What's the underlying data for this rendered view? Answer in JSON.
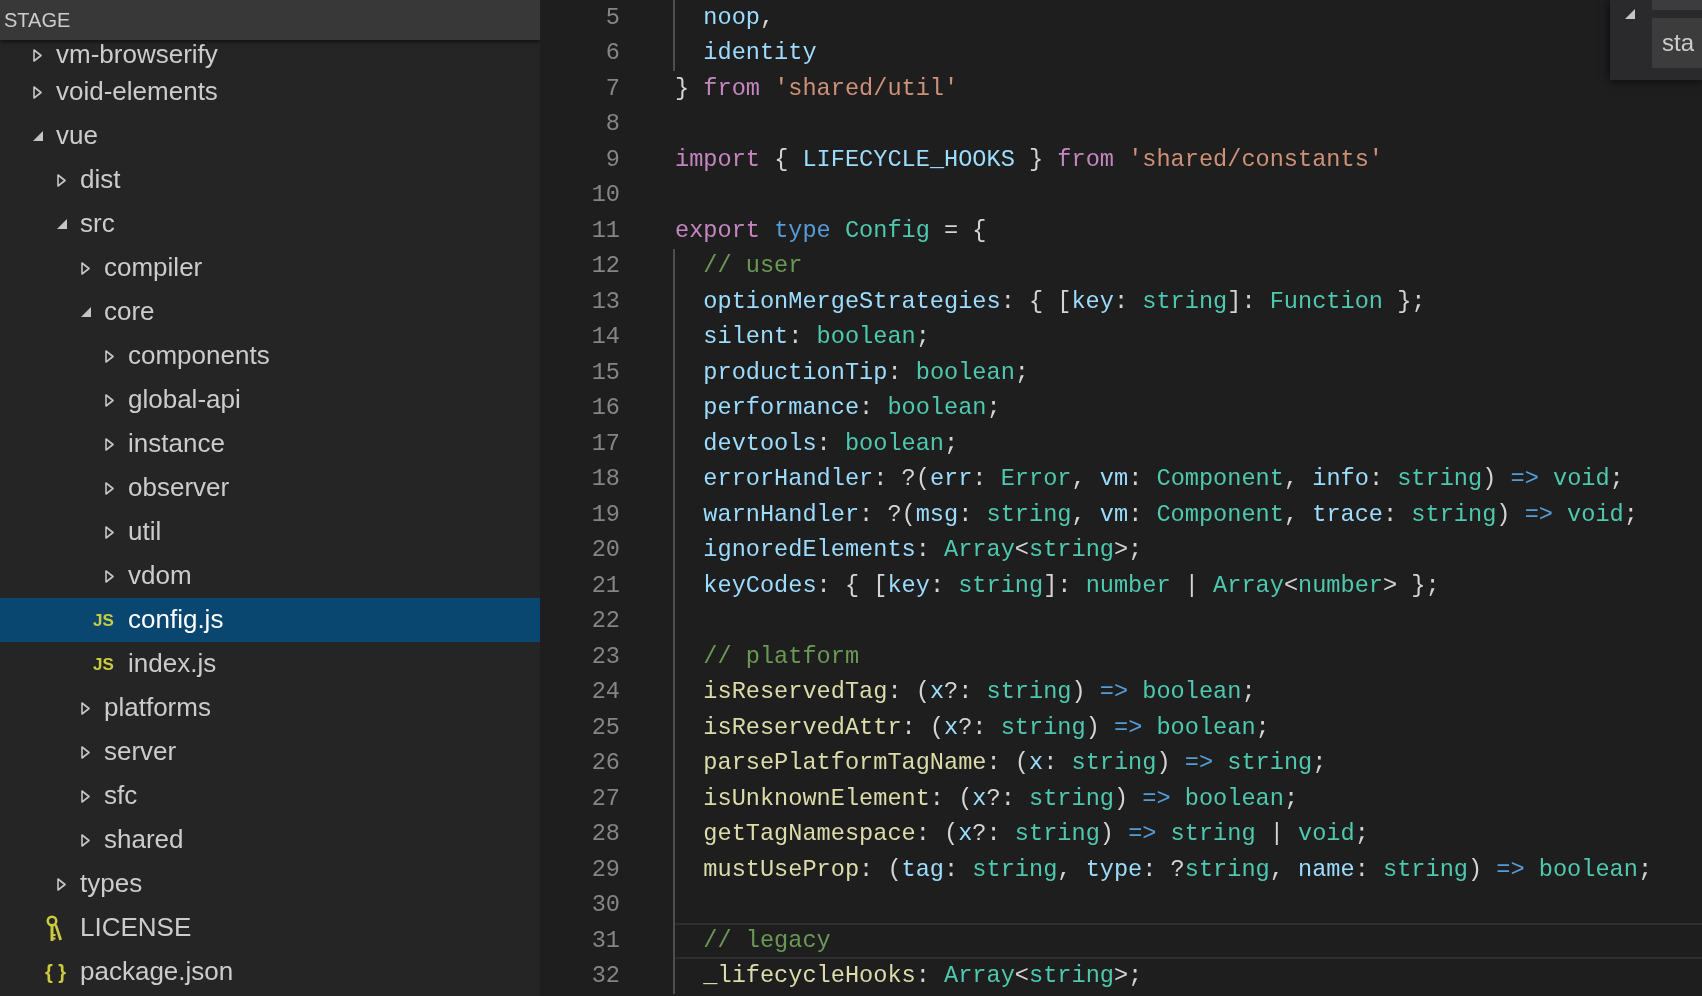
{
  "sidebar": {
    "header": "STAGE",
    "items": [
      {
        "kind": "folder",
        "name": "vm-browserify",
        "expanded": false,
        "selected": false
      },
      {
        "kind": "folder",
        "name": "void-elements",
        "expanded": false,
        "selected": false
      },
      {
        "kind": "folder",
        "name": "vue",
        "expanded": true,
        "selected": false,
        "children": [
          {
            "kind": "folder",
            "name": "dist",
            "expanded": false,
            "selected": false
          },
          {
            "kind": "folder",
            "name": "src",
            "expanded": true,
            "selected": false,
            "children": [
              {
                "kind": "folder",
                "name": "compiler",
                "expanded": false,
                "selected": false
              },
              {
                "kind": "folder",
                "name": "core",
                "expanded": true,
                "selected": false,
                "children": [
                  {
                    "kind": "folder",
                    "name": "components",
                    "expanded": false,
                    "selected": false
                  },
                  {
                    "kind": "folder",
                    "name": "global-api",
                    "expanded": false,
                    "selected": false
                  },
                  {
                    "kind": "folder",
                    "name": "instance",
                    "expanded": false,
                    "selected": false
                  },
                  {
                    "kind": "folder",
                    "name": "observer",
                    "expanded": false,
                    "selected": false
                  },
                  {
                    "kind": "folder",
                    "name": "util",
                    "expanded": false,
                    "selected": false
                  },
                  {
                    "kind": "folder",
                    "name": "vdom",
                    "expanded": false,
                    "selected": false
                  },
                  {
                    "kind": "script",
                    "glyph": "JS",
                    "name": "config.js",
                    "selected": true
                  },
                  {
                    "kind": "script",
                    "glyph": "JS",
                    "name": "index.js",
                    "selected": false
                  }
                ]
              },
              {
                "kind": "folder",
                "name": "platforms",
                "expanded": false,
                "selected": false
              },
              {
                "kind": "folder",
                "name": "server",
                "expanded": false,
                "selected": false
              },
              {
                "kind": "folder",
                "name": "sfc",
                "expanded": false,
                "selected": false
              },
              {
                "kind": "folder",
                "name": "shared",
                "expanded": false,
                "selected": false
              }
            ]
          },
          {
            "kind": "folder",
            "name": "types",
            "expanded": false,
            "selected": false
          },
          {
            "kind": "license",
            "name": "LICENSE",
            "selected": false
          },
          {
            "kind": "json",
            "glyph": "{ }",
            "name": "package.json",
            "selected": false
          }
        ]
      }
    ]
  },
  "editor": {
    "lines": [
      {
        "number": "5",
        "guide": true,
        "current": false,
        "tokens": [
          {
            "kind": "variable",
            "text": "  noop"
          },
          {
            "kind": "punct",
            "text": ","
          }
        ]
      },
      {
        "number": "6",
        "guide": true,
        "current": false,
        "tokens": [
          {
            "kind": "variable",
            "text": "  identity"
          }
        ]
      },
      {
        "number": "7",
        "guide": false,
        "current": false,
        "tokens": [
          {
            "kind": "punct",
            "text": "} "
          },
          {
            "kind": "keyword",
            "text": "from "
          },
          {
            "kind": "string",
            "text": "'shared/util'"
          }
        ]
      },
      {
        "number": "8",
        "guide": false,
        "current": false
      },
      {
        "number": "9",
        "guide": false,
        "current": false,
        "tokens": [
          {
            "kind": "keyword",
            "text": "import "
          },
          {
            "kind": "punct",
            "text": "{ "
          },
          {
            "kind": "variable",
            "text": "LIFECYCLE_HOOKS "
          },
          {
            "kind": "punct",
            "text": "} "
          },
          {
            "kind": "keyword",
            "text": "from "
          },
          {
            "kind": "string",
            "text": "'shared/constants'"
          }
        ]
      },
      {
        "number": "10",
        "guide": false,
        "current": false
      },
      {
        "number": "11",
        "guide": false,
        "current": false,
        "tokens": [
          {
            "kind": "keyword",
            "text": "export "
          },
          {
            "kind": "storage",
            "text": "type "
          },
          {
            "kind": "type",
            "text": "Config "
          },
          {
            "kind": "punct",
            "text": "= {"
          }
        ]
      },
      {
        "number": "12",
        "guide": true,
        "current": false,
        "tokens": [
          {
            "kind": "comment",
            "text": "  // user"
          }
        ]
      },
      {
        "number": "13",
        "guide": true,
        "current": false,
        "tokens": [
          {
            "kind": "variable",
            "text": "  optionMergeStrategies"
          },
          {
            "kind": "punct",
            "text": ": { ["
          },
          {
            "kind": "variable",
            "text": "key"
          },
          {
            "kind": "punct",
            "text": ": "
          },
          {
            "kind": "type",
            "text": "string"
          },
          {
            "kind": "punct",
            "text": "]: "
          },
          {
            "kind": "type",
            "text": "Function"
          },
          {
            "kind": "punct",
            "text": " };"
          }
        ]
      },
      {
        "number": "14",
        "guide": true,
        "current": false,
        "tokens": [
          {
            "kind": "variable",
            "text": "  silent"
          },
          {
            "kind": "punct",
            "text": ": "
          },
          {
            "kind": "type",
            "text": "boolean"
          },
          {
            "kind": "punct",
            "text": ";"
          }
        ]
      },
      {
        "number": "15",
        "guide": true,
        "current": false,
        "tokens": [
          {
            "kind": "variable",
            "text": "  productionTip"
          },
          {
            "kind": "punct",
            "text": ": "
          },
          {
            "kind": "type",
            "text": "boolean"
          },
          {
            "kind": "punct",
            "text": ";"
          }
        ]
      },
      {
        "number": "16",
        "guide": true,
        "current": false,
        "tokens": [
          {
            "kind": "variable",
            "text": "  performance"
          },
          {
            "kind": "punct",
            "text": ": "
          },
          {
            "kind": "type",
            "text": "boolean"
          },
          {
            "kind": "punct",
            "text": ";"
          }
        ]
      },
      {
        "number": "17",
        "guide": true,
        "current": false,
        "tokens": [
          {
            "kind": "variable",
            "text": "  devtools"
          },
          {
            "kind": "punct",
            "text": ": "
          },
          {
            "kind": "type",
            "text": "boolean"
          },
          {
            "kind": "punct",
            "text": ";"
          }
        ]
      },
      {
        "number": "18",
        "guide": true,
        "current": false,
        "tokens": [
          {
            "kind": "variable",
            "text": "  errorHandler"
          },
          {
            "kind": "punct",
            "text": ": ?("
          },
          {
            "kind": "variable",
            "text": "err"
          },
          {
            "kind": "punct",
            "text": ": "
          },
          {
            "kind": "type",
            "text": "Error"
          },
          {
            "kind": "punct",
            "text": ", "
          },
          {
            "kind": "variable",
            "text": "vm"
          },
          {
            "kind": "punct",
            "text": ": "
          },
          {
            "kind": "type",
            "text": "Component"
          },
          {
            "kind": "punct",
            "text": ", "
          },
          {
            "kind": "variable",
            "text": "info"
          },
          {
            "kind": "punct",
            "text": ": "
          },
          {
            "kind": "type",
            "text": "string"
          },
          {
            "kind": "punct",
            "text": ") "
          },
          {
            "kind": "storage",
            "text": "=> "
          },
          {
            "kind": "type",
            "text": "void"
          },
          {
            "kind": "punct",
            "text": ";"
          }
        ]
      },
      {
        "number": "19",
        "guide": true,
        "current": false,
        "tokens": [
          {
            "kind": "variable",
            "text": "  warnHandler"
          },
          {
            "kind": "punct",
            "text": ": ?("
          },
          {
            "kind": "variable",
            "text": "msg"
          },
          {
            "kind": "punct",
            "text": ": "
          },
          {
            "kind": "type",
            "text": "string"
          },
          {
            "kind": "punct",
            "text": ", "
          },
          {
            "kind": "variable",
            "text": "vm"
          },
          {
            "kind": "punct",
            "text": ": "
          },
          {
            "kind": "type",
            "text": "Component"
          },
          {
            "kind": "punct",
            "text": ", "
          },
          {
            "kind": "variable",
            "text": "trace"
          },
          {
            "kind": "punct",
            "text": ": "
          },
          {
            "kind": "type",
            "text": "string"
          },
          {
            "kind": "punct",
            "text": ") "
          },
          {
            "kind": "storage",
            "text": "=> "
          },
          {
            "kind": "type",
            "text": "void"
          },
          {
            "kind": "punct",
            "text": ";"
          }
        ]
      },
      {
        "number": "20",
        "guide": true,
        "current": false,
        "tokens": [
          {
            "kind": "variable",
            "text": "  ignoredElements"
          },
          {
            "kind": "punct",
            "text": ": "
          },
          {
            "kind": "type",
            "text": "Array"
          },
          {
            "kind": "punct",
            "text": "<"
          },
          {
            "kind": "type",
            "text": "string"
          },
          {
            "kind": "punct",
            "text": ">;"
          }
        ]
      },
      {
        "number": "21",
        "guide": true,
        "current": false,
        "tokens": [
          {
            "kind": "variable",
            "text": "  keyCodes"
          },
          {
            "kind": "punct",
            "text": ": { ["
          },
          {
            "kind": "variable",
            "text": "key"
          },
          {
            "kind": "punct",
            "text": ": "
          },
          {
            "kind": "type",
            "text": "string"
          },
          {
            "kind": "punct",
            "text": "]: "
          },
          {
            "kind": "type",
            "text": "number"
          },
          {
            "kind": "punct",
            "text": " | "
          },
          {
            "kind": "type",
            "text": "Array"
          },
          {
            "kind": "punct",
            "text": "<"
          },
          {
            "kind": "type",
            "text": "number"
          },
          {
            "kind": "punct",
            "text": "> };"
          }
        ]
      },
      {
        "number": "22",
        "guide": true,
        "current": false
      },
      {
        "number": "23",
        "guide": true,
        "current": false,
        "tokens": [
          {
            "kind": "comment",
            "text": "  // platform"
          }
        ]
      },
      {
        "number": "24",
        "guide": true,
        "current": false,
        "tokens": [
          {
            "kind": "function",
            "text": "  isReservedTag"
          },
          {
            "kind": "punct",
            "text": ": ("
          },
          {
            "kind": "variable",
            "text": "x"
          },
          {
            "kind": "punct",
            "text": "?: "
          },
          {
            "kind": "type",
            "text": "string"
          },
          {
            "kind": "punct",
            "text": ") "
          },
          {
            "kind": "storage",
            "text": "=> "
          },
          {
            "kind": "type",
            "text": "boolean"
          },
          {
            "kind": "punct",
            "text": ";"
          }
        ]
      },
      {
        "number": "25",
        "guide": true,
        "current": false,
        "tokens": [
          {
            "kind": "function",
            "text": "  isReservedAttr"
          },
          {
            "kind": "punct",
            "text": ": ("
          },
          {
            "kind": "variable",
            "text": "x"
          },
          {
            "kind": "punct",
            "text": "?: "
          },
          {
            "kind": "type",
            "text": "string"
          },
          {
            "kind": "punct",
            "text": ") "
          },
          {
            "kind": "storage",
            "text": "=> "
          },
          {
            "kind": "type",
            "text": "boolean"
          },
          {
            "kind": "punct",
            "text": ";"
          }
        ]
      },
      {
        "number": "26",
        "guide": true,
        "current": false,
        "tokens": [
          {
            "kind": "function",
            "text": "  parsePlatformTagName"
          },
          {
            "kind": "punct",
            "text": ": ("
          },
          {
            "kind": "variable",
            "text": "x"
          },
          {
            "kind": "punct",
            "text": ": "
          },
          {
            "kind": "type",
            "text": "string"
          },
          {
            "kind": "punct",
            "text": ") "
          },
          {
            "kind": "storage",
            "text": "=> "
          },
          {
            "kind": "type",
            "text": "string"
          },
          {
            "kind": "punct",
            "text": ";"
          }
        ]
      },
      {
        "number": "27",
        "guide": true,
        "current": false,
        "tokens": [
          {
            "kind": "function",
            "text": "  isUnknownElement"
          },
          {
            "kind": "punct",
            "text": ": ("
          },
          {
            "kind": "variable",
            "text": "x"
          },
          {
            "kind": "punct",
            "text": "?: "
          },
          {
            "kind": "type",
            "text": "string"
          },
          {
            "kind": "punct",
            "text": ") "
          },
          {
            "kind": "storage",
            "text": "=> "
          },
          {
            "kind": "type",
            "text": "boolean"
          },
          {
            "kind": "punct",
            "text": ";"
          }
        ]
      },
      {
        "number": "28",
        "guide": true,
        "current": false,
        "tokens": [
          {
            "kind": "function",
            "text": "  getTagNamespace"
          },
          {
            "kind": "punct",
            "text": ": ("
          },
          {
            "kind": "variable",
            "text": "x"
          },
          {
            "kind": "punct",
            "text": "?: "
          },
          {
            "kind": "type",
            "text": "string"
          },
          {
            "kind": "punct",
            "text": ") "
          },
          {
            "kind": "storage",
            "text": "=> "
          },
          {
            "kind": "type",
            "text": "string"
          },
          {
            "kind": "punct",
            "text": " | "
          },
          {
            "kind": "type",
            "text": "void"
          },
          {
            "kind": "punct",
            "text": ";"
          }
        ]
      },
      {
        "number": "29",
        "guide": true,
        "current": false,
        "tokens": [
          {
            "kind": "function",
            "text": "  mustUseProp"
          },
          {
            "kind": "punct",
            "text": ": ("
          },
          {
            "kind": "variable",
            "text": "tag"
          },
          {
            "kind": "punct",
            "text": ": "
          },
          {
            "kind": "type",
            "text": "string"
          },
          {
            "kind": "punct",
            "text": ", "
          },
          {
            "kind": "variable",
            "text": "type"
          },
          {
            "kind": "punct",
            "text": ": ?"
          },
          {
            "kind": "type",
            "text": "string"
          },
          {
            "kind": "punct",
            "text": ", "
          },
          {
            "kind": "variable",
            "text": "name"
          },
          {
            "kind": "punct",
            "text": ": "
          },
          {
            "kind": "type",
            "text": "string"
          },
          {
            "kind": "punct",
            "text": ") "
          },
          {
            "kind": "storage",
            "text": "=> "
          },
          {
            "kind": "type",
            "text": "boolean"
          },
          {
            "kind": "punct",
            "text": ";"
          }
        ]
      },
      {
        "number": "30",
        "guide": true,
        "current": false
      },
      {
        "number": "31",
        "guide": true,
        "current": true,
        "tokens": [
          {
            "kind": "comment",
            "text": "  // legacy"
          }
        ]
      },
      {
        "number": "32",
        "guide": true,
        "current": false,
        "tokens": [
          {
            "kind": "function",
            "text": "  _lifecycleHooks"
          },
          {
            "kind": "punct",
            "text": ": "
          },
          {
            "kind": "type",
            "text": "Array"
          },
          {
            "kind": "punct",
            "text": "<"
          },
          {
            "kind": "type",
            "text": "string"
          },
          {
            "kind": "punct",
            "text": ">;"
          }
        ]
      }
    ]
  },
  "find_widget": {
    "expanded": true,
    "field_2": {
      "value": "sta"
    }
  }
}
